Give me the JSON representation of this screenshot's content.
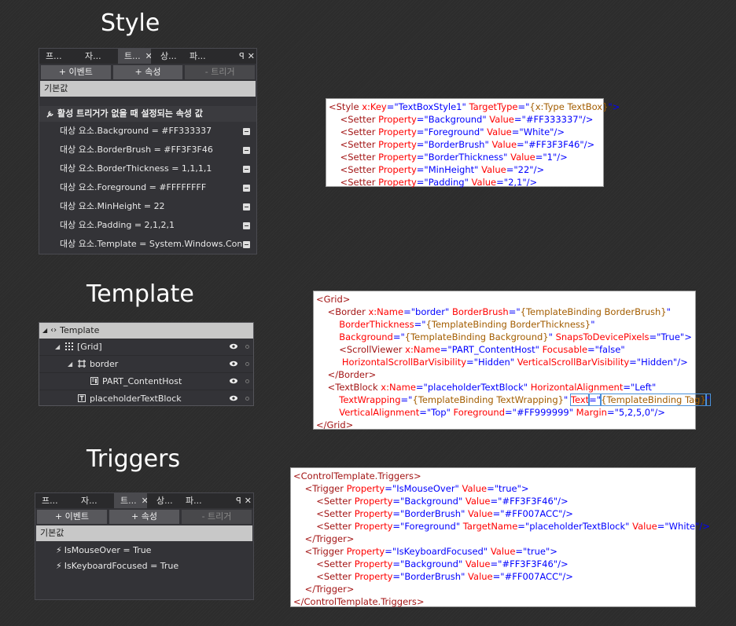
{
  "headings": {
    "style": "Style",
    "template": "Template",
    "triggers": "Triggers"
  },
  "style_panel": {
    "tabs": [
      "프...",
      "자...",
      "트...",
      "상...",
      "파..."
    ],
    "close_glyph": "✕",
    "pin_glyph": "ꟼ",
    "event_button": "+ 이벤트",
    "property_button": "+ 속성",
    "trigger_button": "- 트리거",
    "default_label": "기본값",
    "state_header": "활성 트리거가 없을 때 설정되는 속성 값",
    "setters": [
      "대상 요소.Background = #FF333337",
      "대상 요소.BorderBrush = #FF3F3F46",
      "대상 요소.BorderThickness = 1,1,1,1",
      "대상 요소.Foreground = #FFFFFFFF",
      "대상 요소.MinHeight = 22",
      "대상 요소.Padding = 2,1,2,1",
      "대상 요소.Template = System.Windows.Con..."
    ]
  },
  "template_tree": {
    "root": "Template",
    "items": [
      {
        "label": "[Grid]",
        "icon": "grid-icon"
      },
      {
        "label": "border",
        "icon": "border-icon"
      },
      {
        "label": "PART_ContentHost",
        "icon": "scrollviewer-icon"
      },
      {
        "label": "placeholderTextBlock",
        "icon": "textblock-icon"
      }
    ]
  },
  "triggers_panel": {
    "tabs": [
      "프...",
      "자...",
      "트...",
      "상...",
      "파..."
    ],
    "close_glyph": "✕",
    "pin_glyph": "ꟼ",
    "event_button": "+ 이벤트",
    "property_button": "+ 속성",
    "trigger_button": "- 트리거",
    "default_label": "기본값",
    "triggers": [
      "IsMouseOver = True",
      "IsKeyboardFocused = True"
    ]
  },
  "code_style": [
    [
      [
        "t",
        "<Style "
      ],
      [
        "a",
        "x:Key"
      ],
      [
        "b",
        "=\""
      ],
      [
        "v",
        "TextBoxStyle1"
      ],
      [
        "b",
        "\" "
      ],
      [
        "a",
        "TargetType"
      ],
      [
        "b",
        "=\""
      ],
      [
        "x",
        "{x:Type TextBox}"
      ],
      [
        "b",
        "\">"
      ]
    ],
    [
      [
        "t",
        "    <Setter "
      ],
      [
        "a",
        "Property"
      ],
      [
        "b",
        "=\""
      ],
      [
        "v",
        "Background"
      ],
      [
        "b",
        "\" "
      ],
      [
        "a",
        "Value"
      ],
      [
        "b",
        "=\""
      ],
      [
        "v",
        "#FF333337"
      ],
      [
        "b",
        "\"/>"
      ]
    ],
    [
      [
        "t",
        "    <Setter "
      ],
      [
        "a",
        "Property"
      ],
      [
        "b",
        "=\""
      ],
      [
        "v",
        "Foreground"
      ],
      [
        "b",
        "\" "
      ],
      [
        "a",
        "Value"
      ],
      [
        "b",
        "=\""
      ],
      [
        "v",
        "White"
      ],
      [
        "b",
        "\"/>"
      ]
    ],
    [
      [
        "t",
        "    <Setter "
      ],
      [
        "a",
        "Property"
      ],
      [
        "b",
        "=\""
      ],
      [
        "v",
        "BorderBrush"
      ],
      [
        "b",
        "\" "
      ],
      [
        "a",
        "Value"
      ],
      [
        "b",
        "=\""
      ],
      [
        "v",
        "#FF3F3F46"
      ],
      [
        "b",
        "\"/>"
      ]
    ],
    [
      [
        "t",
        "    <Setter "
      ],
      [
        "a",
        "Property"
      ],
      [
        "b",
        "=\""
      ],
      [
        "v",
        "BorderThickness"
      ],
      [
        "b",
        "\" "
      ],
      [
        "a",
        "Value"
      ],
      [
        "b",
        "=\""
      ],
      [
        "v",
        "1"
      ],
      [
        "b",
        "\"/>"
      ]
    ],
    [
      [
        "t",
        "    <Setter "
      ],
      [
        "a",
        "Property"
      ],
      [
        "b",
        "=\""
      ],
      [
        "v",
        "MinHeight"
      ],
      [
        "b",
        "\" "
      ],
      [
        "a",
        "Value"
      ],
      [
        "b",
        "=\""
      ],
      [
        "v",
        "22"
      ],
      [
        "b",
        "\"/>"
      ]
    ],
    [
      [
        "t",
        "    <Setter "
      ],
      [
        "a",
        "Property"
      ],
      [
        "b",
        "=\""
      ],
      [
        "v",
        "Padding"
      ],
      [
        "b",
        "\" "
      ],
      [
        "a",
        "Value"
      ],
      [
        "b",
        "=\""
      ],
      [
        "v",
        "2,1"
      ],
      [
        "b",
        "\"/>"
      ]
    ]
  ],
  "code_template": [
    [
      [
        "t",
        "<Grid>"
      ]
    ],
    [
      [
        "t",
        "    <Border "
      ],
      [
        "a",
        "x:Name"
      ],
      [
        "b",
        "=\""
      ],
      [
        "v",
        "border"
      ],
      [
        "b",
        "\" "
      ],
      [
        "a",
        "BorderBrush"
      ],
      [
        "b",
        "=\""
      ],
      [
        "x",
        "{TemplateBinding BorderBrush}"
      ],
      [
        "b",
        "\""
      ]
    ],
    [
      [
        "a",
        "        BorderThickness"
      ],
      [
        "b",
        "=\""
      ],
      [
        "x",
        "{TemplateBinding BorderThickness}"
      ],
      [
        "b",
        "\""
      ]
    ],
    [
      [
        "a",
        "        Background"
      ],
      [
        "b",
        "=\""
      ],
      [
        "x",
        "{TemplateBinding Background}"
      ],
      [
        "b",
        "\" "
      ],
      [
        "a",
        "SnapsToDevicePixels"
      ],
      [
        "b",
        "=\""
      ],
      [
        "v",
        "True"
      ],
      [
        "b",
        "\">"
      ]
    ],
    [
      [
        "t",
        "        <ScrollViewer "
      ],
      [
        "a",
        "x:Name"
      ],
      [
        "b",
        "=\""
      ],
      [
        "v",
        "PART_ContentHost"
      ],
      [
        "b",
        "\" "
      ],
      [
        "a",
        "Focusable"
      ],
      [
        "b",
        "=\""
      ],
      [
        "v",
        "false"
      ],
      [
        "b",
        "\""
      ]
    ],
    [
      [
        "a",
        "         HorizontalScrollBarVisibility"
      ],
      [
        "b",
        "=\""
      ],
      [
        "v",
        "Hidden"
      ],
      [
        "b",
        "\" "
      ],
      [
        "a",
        "VerticalScrollBarVisibility"
      ],
      [
        "b",
        "=\""
      ],
      [
        "v",
        "Hidden"
      ],
      [
        "b",
        "\"/>"
      ]
    ],
    [
      [
        "t",
        "    </Border>"
      ]
    ],
    [
      [
        "t",
        "    <TextBlock "
      ],
      [
        "a",
        "x:Name"
      ],
      [
        "b",
        "=\""
      ],
      [
        "v",
        "placeholderTextBlock"
      ],
      [
        "b",
        "\" "
      ],
      [
        "a",
        "HorizontalAlignment"
      ],
      [
        "b",
        "=\""
      ],
      [
        "v",
        "Left"
      ],
      [
        "b",
        "\""
      ]
    ],
    [
      [
        "a",
        "        TextWrapping"
      ],
      [
        "b",
        "=\""
      ],
      [
        "x",
        "{TemplateBinding TextWrapping}"
      ],
      [
        "b",
        "\" "
      ],
      [
        "a",
        "Text"
      ],
      [
        "b",
        "=\""
      ],
      [
        "x",
        "{TemplateBinding Tag}"
      ],
      [
        "b",
        "\""
      ]
    ],
    [
      [
        "a",
        "        VerticalAlignment"
      ],
      [
        "b",
        "=\""
      ],
      [
        "v",
        "Top"
      ],
      [
        "b",
        "\" "
      ],
      [
        "a",
        "Foreground"
      ],
      [
        "b",
        "=\""
      ],
      [
        "v",
        "#FF999999"
      ],
      [
        "b",
        "\" "
      ],
      [
        "a",
        "Margin"
      ],
      [
        "b",
        "=\""
      ],
      [
        "v",
        "5,2,5,0"
      ],
      [
        "b",
        "\"/>"
      ]
    ],
    [
      [
        "t",
        "</Grid>"
      ]
    ]
  ],
  "code_triggers": [
    [
      [
        "t",
        "<ControlTemplate.Triggers>"
      ]
    ],
    [
      [
        "t",
        "    <Trigger "
      ],
      [
        "a",
        "Property"
      ],
      [
        "b",
        "=\""
      ],
      [
        "v",
        "IsMouseOver"
      ],
      [
        "b",
        "\" "
      ],
      [
        "a",
        "Value"
      ],
      [
        "b",
        "=\""
      ],
      [
        "v",
        "true"
      ],
      [
        "b",
        "\">"
      ]
    ],
    [
      [
        "t",
        "        <Setter "
      ],
      [
        "a",
        "Property"
      ],
      [
        "b",
        "=\""
      ],
      [
        "v",
        "Background"
      ],
      [
        "b",
        "\" "
      ],
      [
        "a",
        "Value"
      ],
      [
        "b",
        "=\""
      ],
      [
        "v",
        "#FF3F3F46"
      ],
      [
        "b",
        "\"/>"
      ]
    ],
    [
      [
        "t",
        "        <Setter "
      ],
      [
        "a",
        "Property"
      ],
      [
        "b",
        "=\""
      ],
      [
        "v",
        "BorderBrush"
      ],
      [
        "b",
        "\" "
      ],
      [
        "a",
        "Value"
      ],
      [
        "b",
        "=\""
      ],
      [
        "v",
        "#FF007ACC"
      ],
      [
        "b",
        "\"/>"
      ]
    ],
    [
      [
        "t",
        "        <Setter "
      ],
      [
        "a",
        "Property"
      ],
      [
        "b",
        "=\""
      ],
      [
        "v",
        "Foreground"
      ],
      [
        "b",
        "\" "
      ],
      [
        "a",
        "TargetName"
      ],
      [
        "b",
        "=\""
      ],
      [
        "v",
        "placeholderTextBlock"
      ],
      [
        "b",
        "\" "
      ],
      [
        "a",
        "Value"
      ],
      [
        "b",
        "=\""
      ],
      [
        "v",
        "White"
      ],
      [
        "b",
        "\"/>"
      ]
    ],
    [
      [
        "t",
        "    </Trigger>"
      ]
    ],
    [
      [
        "t",
        "    <Trigger "
      ],
      [
        "a",
        "Property"
      ],
      [
        "b",
        "=\""
      ],
      [
        "v",
        "IsKeyboardFocused"
      ],
      [
        "b",
        "\" "
      ],
      [
        "a",
        "Value"
      ],
      [
        "b",
        "=\""
      ],
      [
        "v",
        "true"
      ],
      [
        "b",
        "\">"
      ]
    ],
    [
      [
        "t",
        "        <Setter "
      ],
      [
        "a",
        "Property"
      ],
      [
        "b",
        "=\""
      ],
      [
        "v",
        "Background"
      ],
      [
        "b",
        "\" "
      ],
      [
        "a",
        "Value"
      ],
      [
        "b",
        "=\""
      ],
      [
        "v",
        "#FF3F3F46"
      ],
      [
        "b",
        "\"/>"
      ]
    ],
    [
      [
        "t",
        "        <Setter "
      ],
      [
        "a",
        "Property"
      ],
      [
        "b",
        "=\""
      ],
      [
        "v",
        "BorderBrush"
      ],
      [
        "b",
        "\" "
      ],
      [
        "a",
        "Value"
      ],
      [
        "b",
        "=\""
      ],
      [
        "v",
        "#FF007ACC"
      ],
      [
        "b",
        "\"/>"
      ]
    ],
    [
      [
        "t",
        "    </Trigger>"
      ]
    ],
    [
      [
        "t",
        "</ControlTemplate.Triggers>"
      ]
    ]
  ]
}
